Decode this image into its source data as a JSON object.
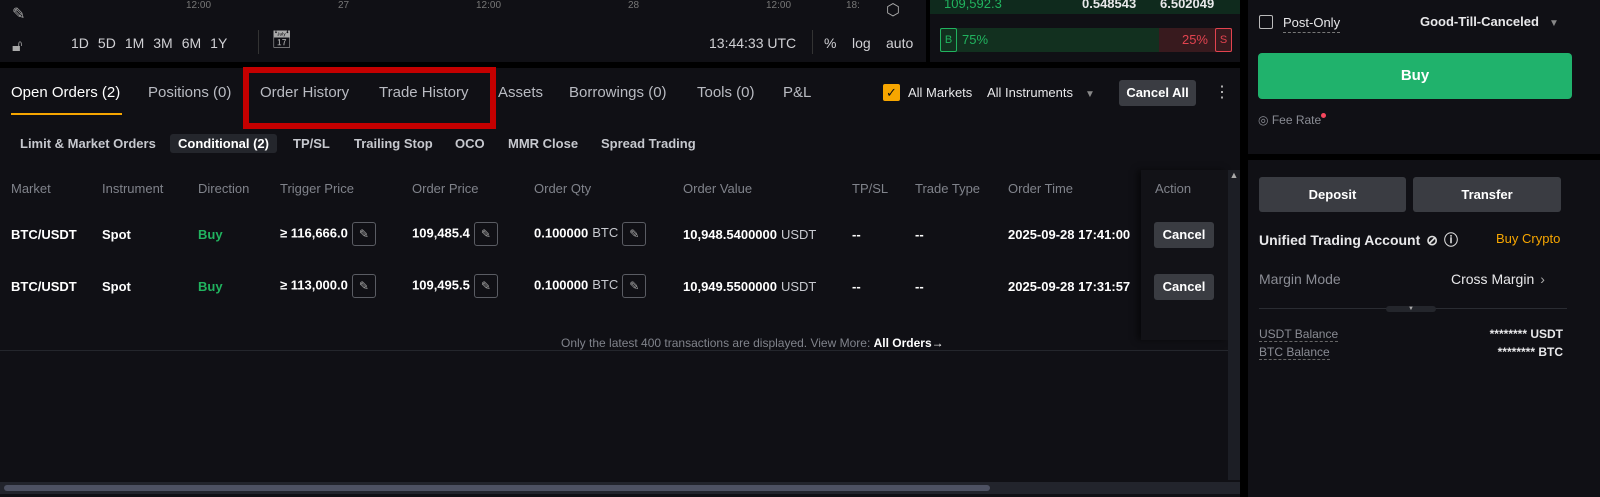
{
  "chart": {
    "time_axis": [
      "12:00",
      "27",
      "12:00",
      "28",
      "12:00",
      "18:"
    ],
    "timeframes": [
      "1D",
      "5D",
      "1M",
      "3M",
      "6M",
      "1Y"
    ],
    "clock": "13:44:33 UTC",
    "scale_options": [
      "%",
      "log",
      "auto"
    ]
  },
  "orderbook": {
    "last_row": {
      "price": "109,592.3",
      "qty": "0.548543",
      "total": "6.502049"
    },
    "buy_label": "B",
    "buy_pct": "75%",
    "sell_label": "S",
    "sell_pct": "25%",
    "buy_ratio": 75
  },
  "tabs": [
    "Open Orders (2)",
    "Positions (0)",
    "Order History",
    "Trade History",
    "Assets",
    "Borrowings (0)",
    "Tools (0)",
    "P&L"
  ],
  "active_tab": "Open Orders (2)",
  "highlight_color": "#c40000",
  "filters": {
    "all_markets": "All Markets",
    "all_markets_checked": true,
    "instrument": "All Instruments",
    "cancel_all": "Cancel All"
  },
  "subtabs": [
    "Limit & Market Orders",
    "Conditional (2)",
    "TP/SL",
    "Trailing Stop",
    "OCO",
    "MMR Close",
    "Spread Trading"
  ],
  "table": {
    "headers": [
      "Market",
      "Instrument",
      "Direction",
      "Trigger Price",
      "Order Price",
      "Order Qty",
      "Order Value",
      "TP/SL",
      "Trade Type",
      "Order Time",
      "Action"
    ],
    "rows": [
      {
        "market": "BTC/USDT",
        "instrument": "Spot",
        "direction": "Buy",
        "trigger": "≥ 116,666.0",
        "price": "109,485.4",
        "qty": "0.100000",
        "qty_unit": "BTC",
        "value": "10,948.5400000",
        "value_unit": "USDT",
        "tpsl": "--",
        "trade_type": "--",
        "time": "2025-09-28 17:41:00",
        "action": "Cancel"
      },
      {
        "market": "BTC/USDT",
        "instrument": "Spot",
        "direction": "Buy",
        "trigger": "≥ 113,000.0",
        "price": "109,495.5",
        "qty": "0.100000",
        "qty_unit": "BTC",
        "value": "10,949.5500000",
        "value_unit": "USDT",
        "tpsl": "--",
        "trade_type": "--",
        "time": "2025-09-28 17:31:57",
        "action": "Cancel"
      }
    ],
    "footer_note": "Only the latest 400 transactions are displayed. View More:",
    "footer_link": "All Orders"
  },
  "trade": {
    "post_only": "Post-Only",
    "tif": "Good-Till-Canceled",
    "buy": "Buy",
    "fee_rate": "Fee Rate",
    "buy_color": "#20b26c"
  },
  "account": {
    "deposit": "Deposit",
    "transfer": "Transfer",
    "title": "Unified Trading Account",
    "buy_crypto": "Buy Crypto",
    "margin_mode_label": "Margin Mode",
    "margin_mode": "Cross Margin",
    "balances": [
      {
        "label": "USDT Balance",
        "value": "******** USDT"
      },
      {
        "label": "BTC Balance",
        "value": "******** BTC"
      }
    ]
  }
}
